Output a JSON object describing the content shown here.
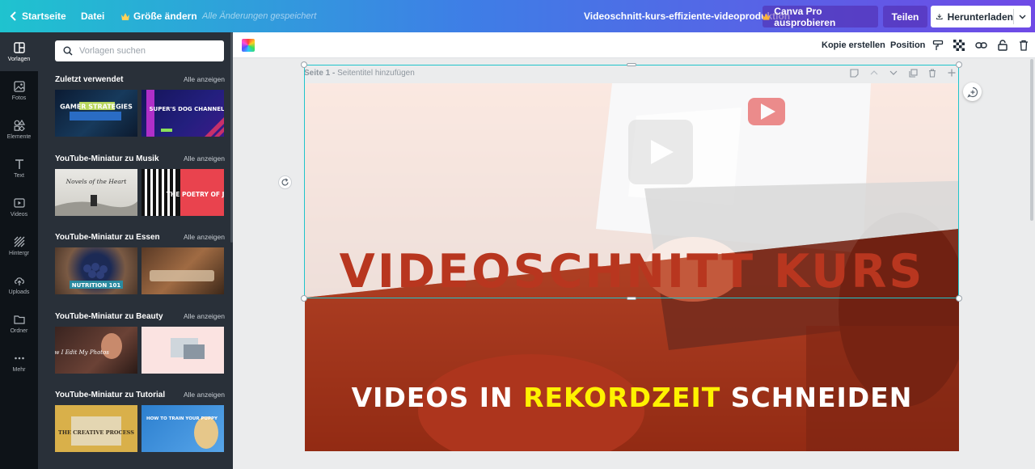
{
  "topbar": {
    "home_label": "Startseite",
    "file_label": "Datei",
    "resize_label": "Größe ändern",
    "saved_status": "Alle Änderungen gespeichert",
    "doc_title": "Videoschnitt-kurs-effiziente-videoproduktion",
    "pro_label": "Canva Pro ausprobieren",
    "share_label": "Teilen",
    "download_label": "Herunterladen"
  },
  "rail": {
    "items": [
      {
        "label": "Vorlagen",
        "icon": "template-icon"
      },
      {
        "label": "Fotos",
        "icon": "photo-icon"
      },
      {
        "label": "Elemente",
        "icon": "elements-icon"
      },
      {
        "label": "Text",
        "icon": "text-icon"
      },
      {
        "label": "Videos",
        "icon": "video-icon"
      },
      {
        "label": "Hintergr",
        "icon": "background-icon"
      },
      {
        "label": "Uploads",
        "icon": "upload-icon"
      },
      {
        "label": "Ordner",
        "icon": "folder-icon"
      },
      {
        "label": "Mehr",
        "icon": "more-icon"
      }
    ]
  },
  "panel": {
    "search_placeholder": "Vorlagen suchen",
    "sections": [
      {
        "title": "Zuletzt verwendet",
        "link": "Alle anzeigen",
        "thumbs": [
          {
            "text": "GAMER STRATEGIES"
          },
          {
            "text": "SUPER'S DOG CHANNEL"
          }
        ]
      },
      {
        "title": "YouTube-Miniatur zu Musik",
        "link": "Alle anzeigen",
        "thumbs": [
          {
            "text": "Novels of the Heart"
          },
          {
            "text": "THE POETRY OF JAZZ"
          }
        ]
      },
      {
        "title": "YouTube-Miniatur zu Essen",
        "link": "Alle anzeigen",
        "thumbs": [
          {
            "text": "NUTRITION 101"
          },
          {
            "text": ""
          }
        ]
      },
      {
        "title": "YouTube-Miniatur zu Beauty",
        "link": "Alle anzeigen",
        "thumbs": [
          {
            "text": "How I Edit My Photos"
          },
          {
            "text": ""
          }
        ]
      },
      {
        "title": "YouTube-Miniatur zu Tutorial",
        "link": "Alle anzeigen",
        "thumbs": [
          {
            "text": "THE CREATIVE PROCESS"
          },
          {
            "text": "HOW TO TRAIN YOUR PUPPY"
          }
        ]
      }
    ]
  },
  "toolbar": {
    "copy_label": "Kopie erstellen",
    "position_label": "Position"
  },
  "page": {
    "label_prefix": "Seite 1 - ",
    "title_placeholder": "Seitentitel hinzufügen"
  },
  "design": {
    "headline": "VIDEOSCHNITT KURS",
    "subline_before": "VIDEOS IN ",
    "subline_highlight": "REKORDZEIT",
    "subline_after": " SCHNEIDEN",
    "headline_color": "#b8361f",
    "highlight_color": "#fff200"
  },
  "colors": {
    "topbar_start": "#1fc3cf",
    "topbar_end": "#6f4ae6",
    "selection": "#20c4cb",
    "panel_bg": "#293039"
  }
}
